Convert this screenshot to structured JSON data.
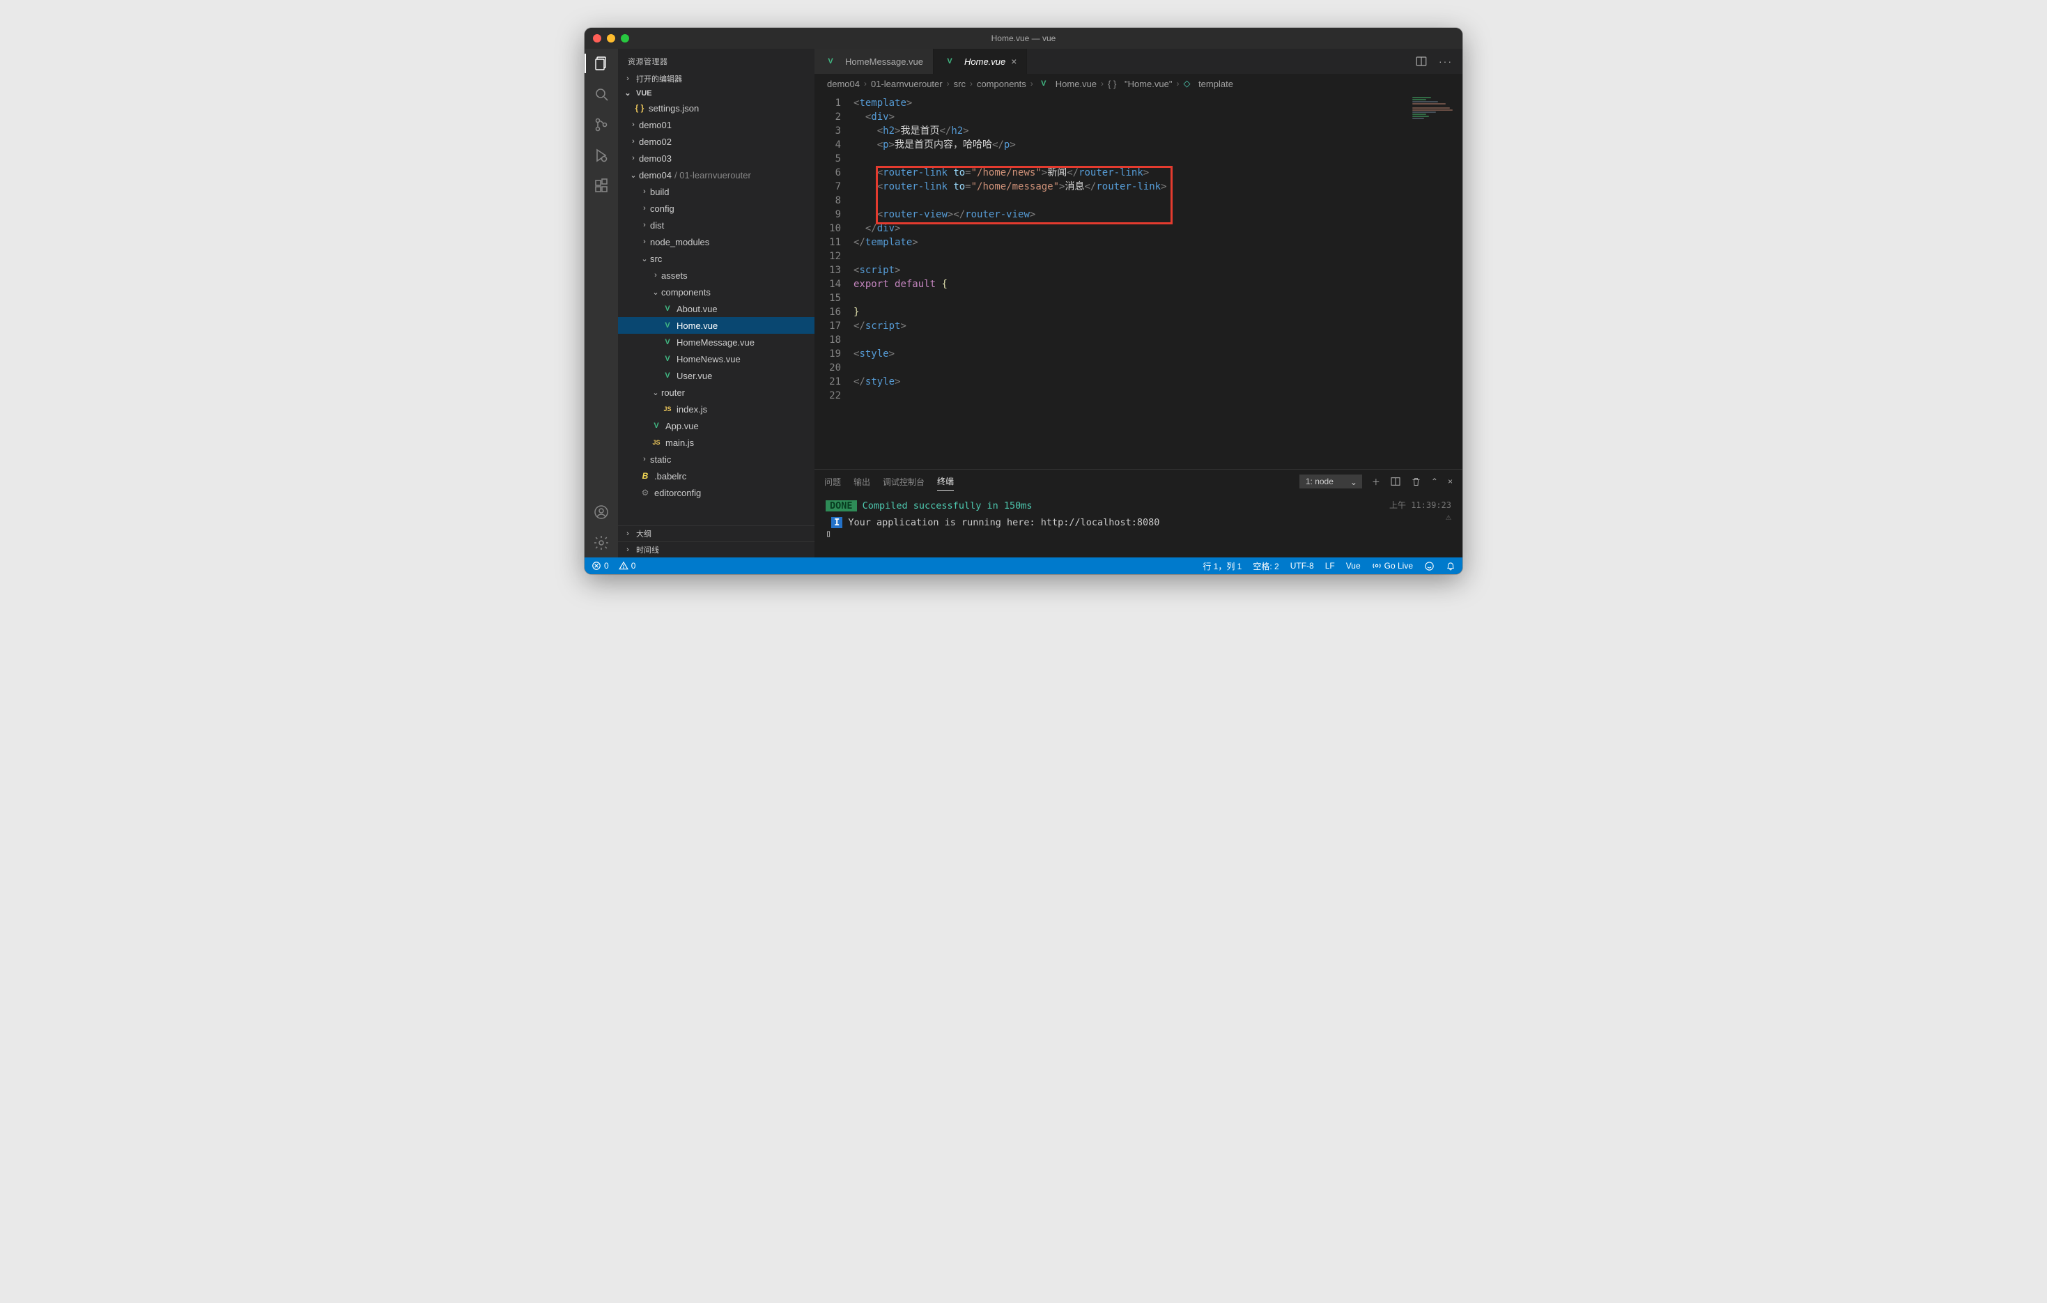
{
  "window": {
    "title": "Home.vue — vue"
  },
  "sidebar": {
    "title": "资源管理器",
    "sections": {
      "open_editors": "打开的编辑器",
      "project": "VUE",
      "outline": "大纲",
      "timeline": "时间线"
    },
    "tree": {
      "settings": "settings.json",
      "demo01": "demo01",
      "demo02": "demo02",
      "demo03": "demo03",
      "demo04": "demo04",
      "demo04_path": "01-learnvuerouter",
      "build": "build",
      "config": "config",
      "dist": "dist",
      "node_modules": "node_modules",
      "src": "src",
      "assets": "assets",
      "components": "components",
      "about": "About.vue",
      "home": "Home.vue",
      "home_message": "HomeMessage.vue",
      "home_news": "HomeNews.vue",
      "user": "User.vue",
      "router": "router",
      "index_js": "index.js",
      "app_vue": "App.vue",
      "main_js": "main.js",
      "static": "static",
      "babelrc": ".babelrc",
      "editorconfig": "editorconfig"
    }
  },
  "tabs": {
    "tab1": "HomeMessage.vue",
    "tab2": "Home.vue"
  },
  "breadcrumbs": {
    "p1": "demo04",
    "p2": "01-learnvuerouter",
    "p3": "src",
    "p4": "components",
    "p5": "Home.vue",
    "p6": "\"Home.vue\"",
    "p7": "template"
  },
  "code": {
    "l1_tag": "template",
    "l2_tag": "div",
    "l3_tag": "h2",
    "l3_text": "我是首页",
    "l4_tag": "p",
    "l4_text": "我是首页内容，哈哈哈",
    "l6_tag": "router-link",
    "l6_attr": "to",
    "l6_val": "\"/home/news\"",
    "l6_text": "新闻",
    "l7_tag": "router-link",
    "l7_attr": "to",
    "l7_val": "\"/home/message\"",
    "l7_text": "消息",
    "l9_tag": "router-view",
    "l13_tag": "script",
    "l14_kw1": "export",
    "l14_kw2": "default",
    "l19_tag": "style",
    "lines": [
      "1",
      "2",
      "3",
      "4",
      "5",
      "6",
      "7",
      "8",
      "9",
      "10",
      "11",
      "12",
      "13",
      "14",
      "15",
      "16",
      "17",
      "18",
      "19",
      "20",
      "21",
      "22"
    ]
  },
  "panel": {
    "tabs": {
      "problems": "问题",
      "output": "输出",
      "debug": "调试控制台",
      "terminal": "终端"
    },
    "select": "1: node",
    "done": "DONE",
    "done_msg": " Compiled successfully in 150ms",
    "info_badge": "I",
    "info_msg": " Your application is running here: http://localhost:8080",
    "timestamp": "上午 11:39:23"
  },
  "statusbar": {
    "errors": "0",
    "warnings": "0",
    "ln_col": "行 1，列 1",
    "spaces": "空格: 2",
    "encoding": "UTF-8",
    "eol": "LF",
    "lang": "Vue",
    "golive": "Go Live"
  }
}
